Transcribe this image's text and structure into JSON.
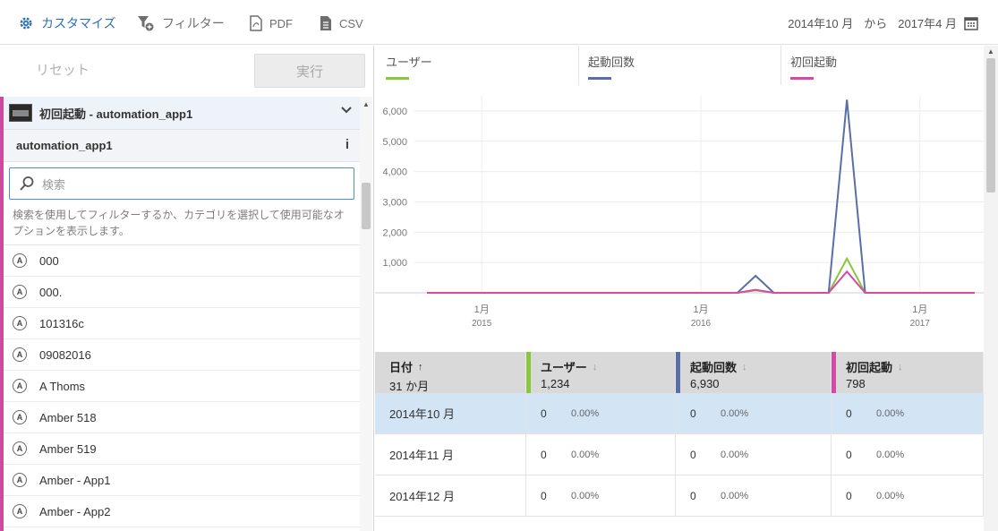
{
  "toolbar": {
    "customize": "カスタマイズ",
    "filter": "フィルター",
    "pdf": "PDF",
    "csv": "CSV",
    "date_from": "2014年10 月",
    "date_sep": "から",
    "date_to": "2017年4 月"
  },
  "left": {
    "reset": "リセット",
    "run": "実行",
    "filter_title": "初回起動 - automation_app1",
    "filter_sub": "automation_app1",
    "info_glyph": "i",
    "search_placeholder": "検索",
    "hint": "検索を使用してフィルターするか、カテゴリを選択して使用可能なオプションを表示します。",
    "items": [
      "000",
      "000.",
      "101316c",
      "09082016",
      "A Thoms",
      "Amber 518",
      "Amber 519",
      "Amber - App1",
      "Amber - App2"
    ]
  },
  "legend": [
    {
      "label": "ユーザー",
      "color": "#8cc63f"
    },
    {
      "label": "起動回数",
      "color": "#5a6fa8"
    },
    {
      "label": "初回起動",
      "color": "#d64aa6"
    }
  ],
  "chart_data": {
    "type": "line",
    "y_ticks": [
      "1,000",
      "2,000",
      "3,000",
      "4,000",
      "5,000",
      "6,000"
    ],
    "ylim": [
      0,
      6500
    ],
    "x_tick_labels": [
      {
        "month": "1月",
        "year": "2015"
      },
      {
        "month": "1月",
        "year": "2016"
      },
      {
        "month": "1月",
        "year": "2017"
      }
    ],
    "x": [
      "2014-10",
      "2014-11",
      "2014-12",
      "2015-01",
      "2015-02",
      "2015-03",
      "2015-04",
      "2015-05",
      "2015-06",
      "2015-07",
      "2015-08",
      "2015-09",
      "2015-10",
      "2015-11",
      "2015-12",
      "2016-01",
      "2016-02",
      "2016-03",
      "2016-04",
      "2016-05",
      "2016-06",
      "2016-07",
      "2016-08",
      "2016-09",
      "2016-10",
      "2016-11",
      "2016-12",
      "2017-01",
      "2017-02",
      "2017-03",
      "2017-04"
    ],
    "series": [
      {
        "name": "ユーザー",
        "color": "#8cc63f",
        "values": [
          0,
          0,
          0,
          0,
          0,
          0,
          0,
          0,
          0,
          0,
          0,
          0,
          0,
          0,
          0,
          0,
          0,
          0,
          80,
          0,
          0,
          0,
          0,
          1130,
          0,
          0,
          0,
          0,
          0,
          0,
          0
        ]
      },
      {
        "name": "起動回数",
        "color": "#5a6fa8",
        "values": [
          0,
          0,
          0,
          0,
          0,
          0,
          0,
          0,
          0,
          0,
          0,
          0,
          0,
          0,
          0,
          0,
          0,
          0,
          560,
          0,
          0,
          0,
          0,
          6370,
          0,
          0,
          0,
          0,
          0,
          0,
          0
        ]
      },
      {
        "name": "初回起動",
        "color": "#d64aa6",
        "values": [
          0,
          0,
          0,
          0,
          0,
          0,
          0,
          0,
          0,
          0,
          0,
          0,
          0,
          0,
          0,
          0,
          0,
          0,
          100,
          0,
          0,
          0,
          0,
          700,
          0,
          0,
          0,
          0,
          0,
          0,
          0
        ]
      }
    ]
  },
  "table": {
    "headers": [
      {
        "label": "日付",
        "value": "31 か月",
        "sort": "↑"
      },
      {
        "label": "ユーザー",
        "value": "1,234",
        "sort": "↓",
        "color": "#8cc63f"
      },
      {
        "label": "起動回数",
        "value": "6,930",
        "sort": "↓",
        "color": "#5a6fa8"
      },
      {
        "label": "初回起動",
        "value": "798",
        "sort": "↓",
        "color": "#d64aa6"
      }
    ],
    "rows": [
      {
        "date": "2014年10 月",
        "u": "0",
        "up": "0.00%",
        "l": "0",
        "lp": "0.00%",
        "f": "0",
        "fp": "0.00%"
      },
      {
        "date": "2014年11 月",
        "u": "0",
        "up": "0.00%",
        "l": "0",
        "lp": "0.00%",
        "f": "0",
        "fp": "0.00%"
      },
      {
        "date": "2014年12 月",
        "u": "0",
        "up": "0.00%",
        "l": "0",
        "lp": "0.00%",
        "f": "0",
        "fp": "0.00%"
      }
    ]
  }
}
